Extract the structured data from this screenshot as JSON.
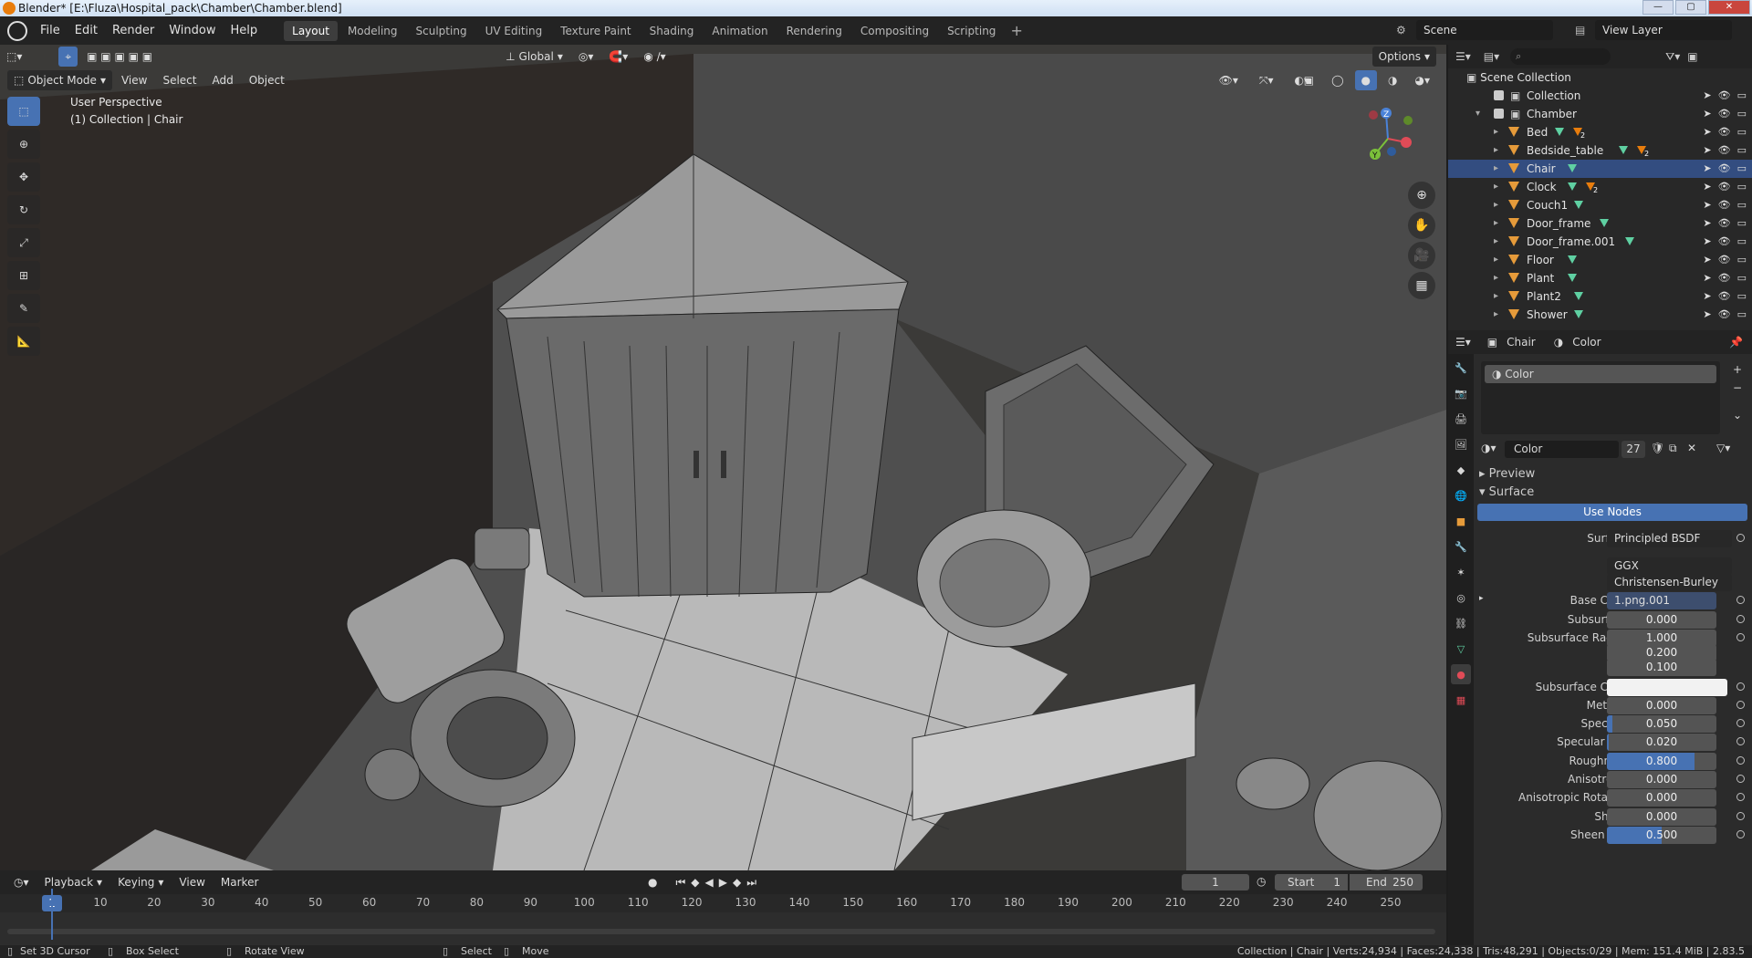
{
  "title": "Blender* [E:\\Fluza\\Hospital_pack\\Chamber\\Chamber.blend]",
  "menus": [
    "File",
    "Edit",
    "Render",
    "Window",
    "Help"
  ],
  "workspaces": [
    "Layout",
    "Modeling",
    "Sculpting",
    "UV Editing",
    "Texture Paint",
    "Shading",
    "Animation",
    "Rendering",
    "Compositing",
    "Scripting"
  ],
  "active_workspace": "Layout",
  "scene": "Scene",
  "view_layer": "View Layer",
  "viewport": {
    "transform_orientation": "Global",
    "options_label": "Options",
    "mode": "Object Mode",
    "menus": [
      "View",
      "Select",
      "Add",
      "Object"
    ],
    "perspective_label": "User Perspective",
    "collection_label": "(1) Collection | Chair",
    "gizmo_axes": [
      "X",
      "Y",
      "Z"
    ]
  },
  "outliner": {
    "root": "Scene Collection",
    "items": [
      {
        "label": "Collection",
        "level": 0,
        "type": "collection"
      },
      {
        "label": "Chamber",
        "level": 0,
        "type": "collection",
        "expanded": true
      },
      {
        "label": "Bed",
        "level": 1,
        "type": "object",
        "mat_count": "2"
      },
      {
        "label": "Bedside_table",
        "level": 1,
        "type": "object",
        "mat_count": "2"
      },
      {
        "label": "Chair",
        "level": 1,
        "type": "object",
        "active": true
      },
      {
        "label": "Clock",
        "level": 1,
        "type": "object",
        "mat_count": "2"
      },
      {
        "label": "Couch1",
        "level": 1,
        "type": "object"
      },
      {
        "label": "Door_frame",
        "level": 1,
        "type": "object"
      },
      {
        "label": "Door_frame.001",
        "level": 1,
        "type": "object"
      },
      {
        "label": "Floor",
        "level": 1,
        "type": "object"
      },
      {
        "label": "Plant",
        "level": 1,
        "type": "object"
      },
      {
        "label": "Plant2",
        "level": 1,
        "type": "object"
      },
      {
        "label": "Shower",
        "level": 1,
        "type": "object"
      }
    ]
  },
  "properties": {
    "breadcrumb_object": "Chair",
    "breadcrumb_material": "Color",
    "slot_name": "Color",
    "material_name": "Color",
    "users": "27",
    "preview_label": "Preview",
    "surface_label": "Surface",
    "use_nodes_label": "Use Nodes",
    "surface_shader_label": "Surface",
    "surface_shader": "Principled BSDF",
    "distribution": "GGX",
    "subsurface_method": "Christensen-Burley",
    "base_color_label": "Base Color",
    "base_color_value": "1.png.001",
    "fields": [
      {
        "label": "Subsurface",
        "value": "0.000",
        "fill": 0
      },
      {
        "label": "Subsurface Radius",
        "value": "1.000",
        "fill": 0
      },
      {
        "label": "",
        "value": "0.200",
        "fill": 0
      },
      {
        "label": "",
        "value": "0.100",
        "fill": 0
      },
      {
        "label": "Subsurface Color",
        "value": "",
        "fill": 0,
        "color": "#f2f2f2"
      },
      {
        "label": "Metallic",
        "value": "0.000",
        "fill": 0
      },
      {
        "label": "Specular",
        "value": "0.050",
        "fill": 0.05
      },
      {
        "label": "Specular Tint",
        "value": "0.020",
        "fill": 0.02
      },
      {
        "label": "Roughness",
        "value": "0.800",
        "fill": 0.8
      },
      {
        "label": "Anisotropic",
        "value": "0.000",
        "fill": 0
      },
      {
        "label": "Anisotropic Rotation",
        "value": "0.000",
        "fill": 0
      },
      {
        "label": "Sheen",
        "value": "0.000",
        "fill": 0
      },
      {
        "label": "Sheen Tint",
        "value": "0.500",
        "fill": 0.5
      }
    ]
  },
  "timeline": {
    "menus": [
      "Playback",
      "Keying",
      "View",
      "Marker"
    ],
    "current_frame": "1",
    "start_label": "Start",
    "start": "1",
    "end_label": "End",
    "end": "250",
    "ticks": [
      "10",
      "20",
      "30",
      "40",
      "50",
      "60",
      "70",
      "80",
      "90",
      "100",
      "110",
      "120",
      "130",
      "140",
      "150",
      "160",
      "170",
      "180",
      "190",
      "200",
      "210",
      "220",
      "230",
      "240",
      "250"
    ]
  },
  "status": {
    "left": [
      "Set 3D Cursor",
      "Box Select",
      "Rotate View",
      "Select",
      "Move"
    ],
    "right": "Collection | Chair | Verts:24,934 | Faces:24,338 | Tris:48,291 | Objects:0/29 | Mem: 151.4 MiB | 2.83.5"
  },
  "colors": {
    "accent": "#4772b3",
    "object": "#e69b3a",
    "mesh": "#5fd0a2",
    "active_row": "#334d80"
  }
}
